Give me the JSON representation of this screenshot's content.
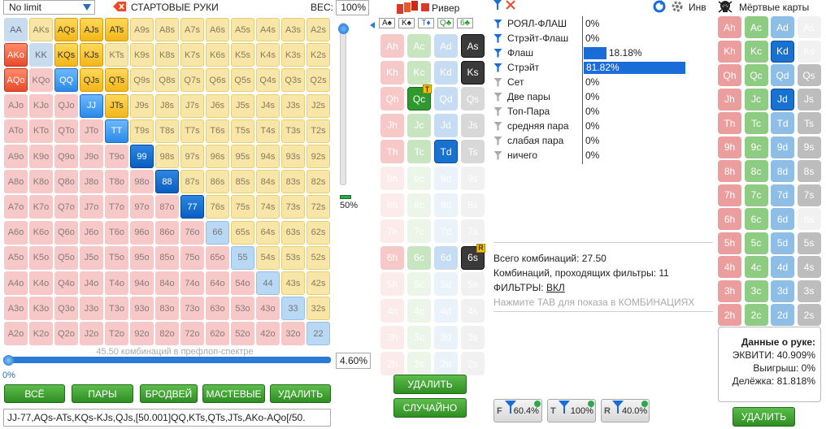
{
  "game_select": {
    "value": "No limit"
  },
  "header": {
    "starting_hands": "СТАРТОВЫЕ РУКИ",
    "weight_label": "ВЕС:",
    "weight_value": "100%",
    "river_label": "Ривер",
    "inv_label": "Инв",
    "dead_cards_label": "Мёртвые карты"
  },
  "board_cards": [
    "A♠",
    "K♠",
    "T♦",
    "Q♣",
    "6♣"
  ],
  "grid": {
    "rows": [
      [
        "AA",
        "AKs",
        "AQs",
        "AJs",
        "ATs",
        "A9s",
        "A8s",
        "A7s",
        "A6s",
        "A5s",
        "A4s",
        "A3s",
        "A2s"
      ],
      [
        "AKo",
        "KK",
        "KQs",
        "KJs",
        "KTs",
        "K9s",
        "K8s",
        "K7s",
        "K6s",
        "K5s",
        "K4s",
        "K3s",
        "K2s"
      ],
      [
        "AQo",
        "KQo",
        "QQ",
        "QJs",
        "QTs",
        "Q9s",
        "Q8s",
        "Q7s",
        "Q6s",
        "Q5s",
        "Q4s",
        "Q3s",
        "Q2s"
      ],
      [
        "AJo",
        "KJo",
        "QJo",
        "JJ",
        "JTs",
        "J9s",
        "J8s",
        "J7s",
        "J6s",
        "J5s",
        "J4s",
        "J3s",
        "J2s"
      ],
      [
        "ATo",
        "KTo",
        "QTo",
        "JTo",
        "TT",
        "T9s",
        "T8s",
        "T7s",
        "T6s",
        "T5s",
        "T4s",
        "T3s",
        "T2s"
      ],
      [
        "A9o",
        "K9o",
        "Q9o",
        "J9o",
        "T9o",
        "99",
        "98s",
        "97s",
        "96s",
        "95s",
        "94s",
        "93s",
        "92s"
      ],
      [
        "A8o",
        "K8o",
        "Q8o",
        "J8o",
        "T8o",
        "98o",
        "88",
        "87s",
        "86s",
        "85s",
        "84s",
        "83s",
        "82s"
      ],
      [
        "A7o",
        "K7o",
        "Q7o",
        "J7o",
        "T7o",
        "97o",
        "87o",
        "77",
        "76s",
        "75s",
        "74s",
        "73s",
        "72s"
      ],
      [
        "A6o",
        "K6o",
        "Q6o",
        "J6o",
        "T6o",
        "96o",
        "86o",
        "76o",
        "66",
        "65s",
        "64s",
        "63s",
        "62s"
      ],
      [
        "A5o",
        "K5o",
        "Q5o",
        "J5o",
        "T5o",
        "95o",
        "85o",
        "75o",
        "65o",
        "55",
        "54s",
        "53s",
        "52s"
      ],
      [
        "A4o",
        "K4o",
        "Q4o",
        "J4o",
        "T4o",
        "94o",
        "84o",
        "74o",
        "64o",
        "54o",
        "44",
        "43s",
        "42s"
      ],
      [
        "A3o",
        "K3o",
        "Q3o",
        "J3o",
        "T3o",
        "93o",
        "83o",
        "73o",
        "63o",
        "53o",
        "43o",
        "33",
        "32s"
      ],
      [
        "A2o",
        "K2o",
        "Q2o",
        "J2o",
        "T2o",
        "92o",
        "82o",
        "72o",
        "62o",
        "52o",
        "42o",
        "32o",
        "22"
      ]
    ]
  },
  "slider": {
    "combos_text": "45.50 комбинаций в префлоп-спектре",
    "percent": "4.60%",
    "min_label": "0%",
    "weight_pct": "50%",
    "weight_fraction": 0.5
  },
  "buttons": {
    "all": "ВСЁ",
    "pairs": "ПАРЫ",
    "broadway": "БРОДВЕЙ",
    "suited": "МАСТЕВЫЕ",
    "delete": "УДАЛИТЬ",
    "delete_mid": "УДАЛИТЬ",
    "random": "СЛУЧАЙНО",
    "delete_right": "УДАЛИТЬ"
  },
  "range_text": "JJ-77,AQs-ATs,KQs-KJs,QJs,[50.001]QQ,KTs,QTs,JTs,AKo-AQo[/50.",
  "river_cards": [
    [
      "Ah",
      "Ac",
      "Ad",
      "As"
    ],
    [
      "Kh",
      "Kc",
      "Kd",
      "Ks"
    ],
    [
      "Qh",
      "Qc",
      "Qd",
      "Qs"
    ],
    [
      "Jh",
      "Jc",
      "Jd",
      "Js"
    ],
    [
      "Th",
      "Tc",
      "Td",
      "Ts"
    ],
    [
      "9h",
      "9c",
      "9d",
      "9s"
    ],
    [
      "8h",
      "8c",
      "8d",
      "8s"
    ],
    [
      "7h",
      "7c",
      "7d",
      "7s"
    ],
    [
      "6h",
      "6c",
      "6d",
      "6s"
    ],
    [
      "5h",
      "5c",
      "5d",
      "5s"
    ],
    [
      "4h",
      "4c",
      "4d",
      "4s"
    ],
    [
      "3h",
      "3c",
      "3d",
      "3s"
    ],
    [
      "2h",
      "2c",
      "2d",
      "2s"
    ]
  ],
  "hands": [
    {
      "name": "РОЯЛ-ФЛАШ",
      "pct": "0%",
      "value": 0
    },
    {
      "name": "Стрэйт-Флаш",
      "pct": "0%",
      "value": 0
    },
    {
      "name": "Флаш",
      "pct": "18.18%",
      "value": 18.18
    },
    {
      "name": "Стрэйт",
      "pct": "81.82%",
      "value": 81.82
    },
    {
      "name": "Сет",
      "pct": "0%",
      "value": 0
    },
    {
      "name": "Две пары",
      "pct": "0%",
      "value": 0
    },
    {
      "name": "Топ-Пара",
      "pct": "0%",
      "value": 0
    },
    {
      "name": "средняя пара",
      "pct": "0%",
      "value": 0
    },
    {
      "name": "слабая пара",
      "pct": "0%",
      "value": 0
    },
    {
      "name": "ничего",
      "pct": "0%",
      "value": 0
    }
  ],
  "stats": {
    "total": "Всего комбинаций: 27.50",
    "passed": "Комбинаций, проходящих фильтры: 11",
    "filters_label": "ФИЛЬТРЫ:",
    "filters_value": "ВКЛ",
    "hint": "Нажмите TAB для показа в КОМБИНАЦИЯХ"
  },
  "filter_buttons": [
    {
      "letter": "F",
      "pct": "60.4%"
    },
    {
      "letter": "T",
      "pct": "100%"
    },
    {
      "letter": "R",
      "pct": "40.0%"
    }
  ],
  "hand_data": {
    "title": "Данные о руке:",
    "equity": "ЭКВИТИ: 40.909%",
    "win": "Выигрыш: 0%",
    "tie": "Делёжка: 81.818%"
  },
  "colors": {
    "flush_bar": "#1a6cd8",
    "green": "#2e8e22"
  }
}
